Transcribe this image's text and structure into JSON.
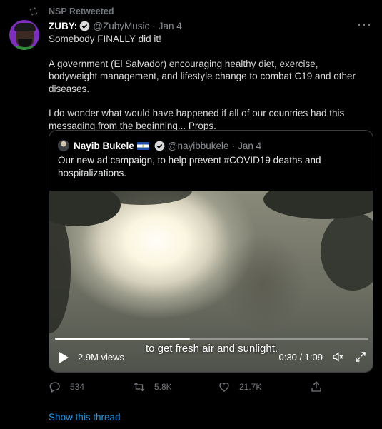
{
  "retweet": {
    "label": "NSP Retweeted",
    "icon": "retweet-icon"
  },
  "tweet": {
    "name": "ZUBY:",
    "handle": "@ZubyMusic",
    "separator": "·",
    "date": "Jan 4",
    "more": "···",
    "text": [
      "Somebody FINALLY did it!",
      "A government (El Salvador) encouraging healthy diet, exercise, bodyweight management, and lifestyle change to combat C19 and other diseases.",
      "I do wonder what would have happened if all of our countries had this messaging from the beginning... Props."
    ]
  },
  "quote": {
    "name": "Nayib Bukele",
    "handle": "@nayibbukele",
    "separator": "·",
    "date": "Jan 4",
    "text": "Our new ad campaign, to help prevent #COVID19 deaths and hospitalizations."
  },
  "video": {
    "caption": "to get fresh air and sunlight.",
    "views": "2.9M views",
    "time": "0:30 / 1:09",
    "progress_fraction": 0.43
  },
  "actions": {
    "reply": "534",
    "retweet": "5.8K",
    "like": "21.7K"
  },
  "show_thread": "Show this thread",
  "colors": {
    "link": "#1d9bf0",
    "verified": "#ffffff",
    "background": "#000000",
    "muted": "#71767b"
  }
}
